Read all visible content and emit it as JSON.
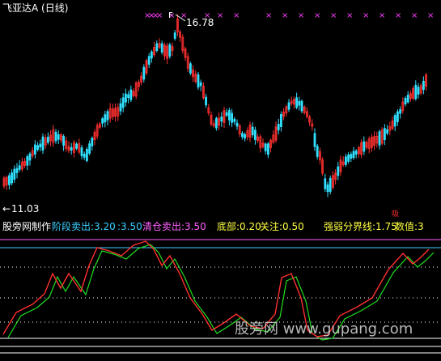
{
  "header": {
    "title": "飞亚达A (日线)",
    "title_color": "#ffffff"
  },
  "price_chart": {
    "high_label": "16.78",
    "low_label": "11.03",
    "low_arrow": "←",
    "up_color": "#ff3030",
    "down_color": "#30e0ff",
    "marker_color": "#ff40ff",
    "marker_glyph": "×",
    "signal_glyph": "吸"
  },
  "indicator": {
    "author": "股旁网制作",
    "labels": [
      {
        "text": "阶段卖出:3.20",
        "color": "#3ad0ff"
      },
      {
        "text": ":3.50",
        "color": "#3ad0ff"
      },
      {
        "text": "清仓卖出:3.50",
        "color": "#ff60ff"
      },
      {
        "text": "底部:0.20",
        "color": "#ffff40"
      },
      {
        "text": "关注:0.50",
        "color": "#ffff40"
      },
      {
        "text": "强弱分界线:1.75",
        "color": "#ffff40"
      },
      {
        "text": "数值:3",
        "color": "#ffff40"
      }
    ],
    "line_colors": {
      "red": "#ff3030",
      "green": "#20e020",
      "magenta": "#ff60ff",
      "cyan": "#40d0ff",
      "white": "#ffffff"
    }
  },
  "watermark": {
    "text": "股旁网 www.gupang.com"
  }
}
